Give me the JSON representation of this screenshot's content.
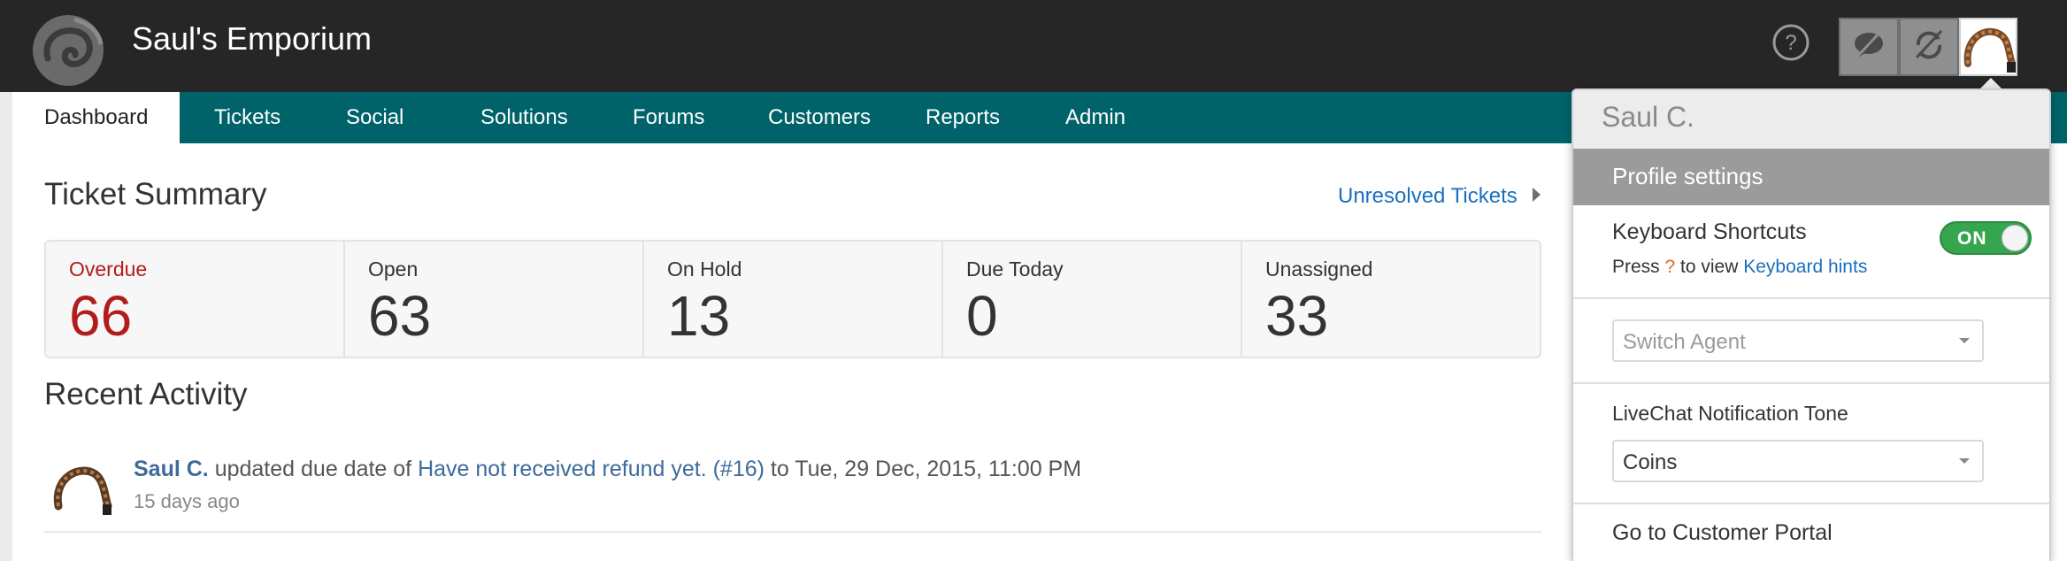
{
  "app": {
    "title": "Saul's Emporium",
    "logo_icon": "swirl-logo-icon",
    "brand_color": "#00636a"
  },
  "toolbar": {
    "help_icon": "help-circle-icon",
    "buttons": [
      "chat-off-icon",
      "sync-off-icon"
    ],
    "avatar_icon": "user-avatar-icon"
  },
  "nav": {
    "tabs": [
      {
        "label": "Dashboard",
        "active": true
      },
      {
        "label": "Tickets"
      },
      {
        "label": "Social"
      },
      {
        "label": "Solutions"
      },
      {
        "label": "Forums"
      },
      {
        "label": "Customers"
      },
      {
        "label": "Reports"
      },
      {
        "label": "Admin"
      }
    ]
  },
  "ticket_summary": {
    "title": "Ticket Summary",
    "link": "Unresolved Tickets",
    "cells": [
      {
        "label": "Overdue",
        "value": "66",
        "color": "#b21c1c"
      },
      {
        "label": "Open",
        "value": "63"
      },
      {
        "label": "On Hold",
        "value": "13"
      },
      {
        "label": "Due Today",
        "value": "0"
      },
      {
        "label": "Unassigned",
        "value": "33"
      }
    ]
  },
  "recent_activity": {
    "title": "Recent Activity",
    "items": [
      {
        "user": "Saul C.",
        "action": " updated due date of ",
        "ticket": "Have not received refund yet. (#16)",
        "suffix": " to Tue, 29 Dec, 2015, 11:00 PM",
        "time": "15 days ago"
      }
    ]
  },
  "profile_menu": {
    "user_name": "Saul C.",
    "profile_settings": "Profile settings",
    "keyboard_shortcuts": {
      "label": "Keyboard Shortcuts",
      "toggle": "ON",
      "hint_prefix": "Press ",
      "hint_key": "?",
      "hint_middle": " to view ",
      "hint_link": "Keyboard hints"
    },
    "switch_agent": {
      "value": "Switch Agent"
    },
    "livechat_tone": {
      "label": "LiveChat Notification Tone",
      "value": "Coins"
    },
    "customer_portal": "Go to Customer Portal"
  }
}
